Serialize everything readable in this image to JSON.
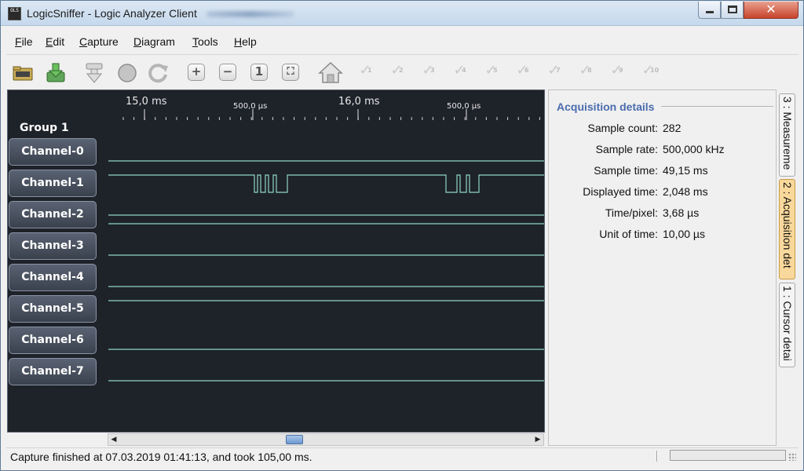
{
  "window": {
    "title": "LogicSniffer - Logic Analyzer Client",
    "icon_text": "OLS",
    "buttons": {
      "minimize": "minimize-icon",
      "maximize": "maximize-icon",
      "close": "close-icon",
      "close_glyph": "✕"
    }
  },
  "menu": [
    {
      "label": "File",
      "mnemonic": "F",
      "rest": "ile"
    },
    {
      "label": "Edit",
      "mnemonic": "E",
      "rest": "dit"
    },
    {
      "label": "Capture",
      "mnemonic": "C",
      "rest": "apture"
    },
    {
      "label": "Diagram",
      "mnemonic": "D",
      "rest": "iagram"
    },
    {
      "label": "Tools",
      "mnemonic": "T",
      "rest": "ools"
    },
    {
      "label": "Help",
      "mnemonic": "H",
      "rest": "elp"
    }
  ],
  "toolbar": {
    "icons": [
      "open-icon",
      "save-icon",
      "capture-icon",
      "stop-icon",
      "repeat-capture-icon",
      "zoom-in-icon",
      "zoom-out-icon",
      "zoom-default-icon",
      "zoom-all-icon",
      "home-icon"
    ],
    "cursors": [
      "1",
      "2",
      "3",
      "4",
      "5",
      "6",
      "7",
      "8",
      "9",
      "10"
    ],
    "zoom_in_glyph": "+",
    "zoom_out_glyph": "−",
    "zoom_default_glyph": "1",
    "zoom_all_glyph": "⛶"
  },
  "timeline": {
    "major_labels": [
      "15,0 ms",
      "16,0 ms"
    ],
    "minor_labels": [
      "500,0 µs",
      "500,0 µs"
    ]
  },
  "group": {
    "label": "Group 1"
  },
  "channels": [
    "Channel-0",
    "Channel-1",
    "Channel-2",
    "Channel-3",
    "Channel-4",
    "Channel-5",
    "Channel-6",
    "Channel-7"
  ],
  "signal_color": "#8fd6c8",
  "details": {
    "heading": "Acquisition details",
    "rows": [
      {
        "label": "Sample count:",
        "value": "282"
      },
      {
        "label": "Sample rate:",
        "value": "500,000 kHz"
      },
      {
        "label": "Sample time:",
        "value": "49,15 ms"
      },
      {
        "label": "Displayed time:",
        "value": "2,048 ms"
      },
      {
        "label": "Time/pixel:",
        "value": "3,68 µs"
      },
      {
        "label": "Unit of time:",
        "value": "10,00 µs"
      }
    ]
  },
  "side_tabs": [
    "3 : Measureme",
    "2 : Acquisition det",
    "1 : Cursor detai"
  ],
  "status": {
    "message": "Capture finished at 07.03.2019 01:41:13, and took 105,00 ms."
  }
}
